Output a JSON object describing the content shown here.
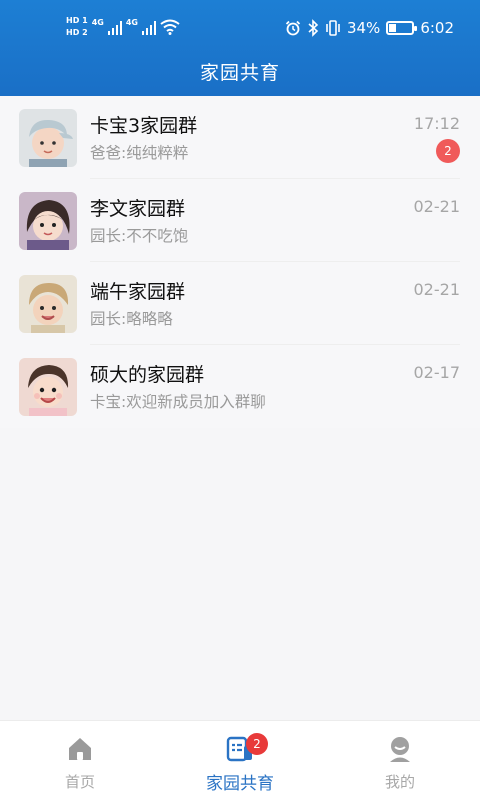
{
  "status_bar": {
    "hd1": "HD 1",
    "hd2": "HD 2",
    "net1": "4G",
    "net2": "4G",
    "battery_percent": "34%",
    "battery_level": 0.34,
    "time": "6:02",
    "icons": [
      "alarm-icon",
      "bluetooth-icon",
      "vibrate-icon",
      "battery-icon",
      "wifi-icon",
      "signal-icon"
    ]
  },
  "header": {
    "title": "家园共育"
  },
  "chats": [
    {
      "name": "卡宝3家园群",
      "last_message": "爸爸:纯纯粹粹",
      "time": "17:12",
      "unread": "2"
    },
    {
      "name": "李文家园群",
      "last_message": "园长:不不吃饱",
      "time": "02-21",
      "unread": ""
    },
    {
      "name": "端午家园群",
      "last_message": "园长:略略略",
      "time": "02-21",
      "unread": ""
    },
    {
      "name": "硕大的家园群",
      "last_message": "卡宝:欢迎新成员加入群聊",
      "time": "02-17",
      "unread": ""
    }
  ],
  "tabbar": {
    "tabs": [
      {
        "label": "首页",
        "icon": "home-icon",
        "badge": ""
      },
      {
        "label": "家园共育",
        "icon": "chat-list-icon",
        "badge": "2"
      },
      {
        "label": "我的",
        "icon": "profile-icon",
        "badge": ""
      }
    ],
    "active_color": "#2a73c4",
    "inactive_color": "#a8a8a8"
  },
  "colors": {
    "header": "#1a74cc",
    "badge": "#f05a5a"
  }
}
